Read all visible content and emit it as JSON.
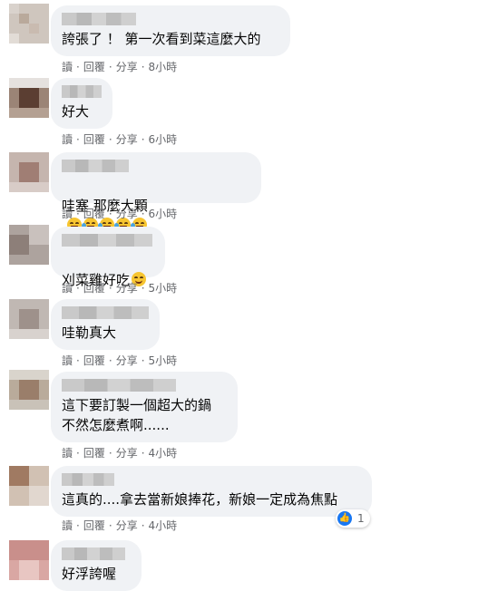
{
  "actions": {
    "read": "讀",
    "reply": "回覆",
    "share": "分享",
    "dot": "·"
  },
  "comments": [
    {
      "text": "誇張了 ！ 第一次看到菜這麼大的",
      "time": "8小時"
    },
    {
      "text": "好大",
      "time": "6小時"
    },
    {
      "text": "哇塞 那麼大顆",
      "time": "6小時",
      "emojis": [
        "grin-sweat",
        "rofl",
        "rofl",
        "rofl",
        "rofl"
      ]
    },
    {
      "text": "刈菜雞好吃",
      "time": "5小時",
      "emojis": [
        "smile"
      ]
    },
    {
      "text": "哇勒真大",
      "time": "5小時"
    },
    {
      "text": "這下要訂製一個超大的鍋\n不然怎麼煮啊......",
      "time": "4小時"
    },
    {
      "text": "這真的....拿去當新娘捧花，新娘一定成為焦點",
      "time": "4小時",
      "reaction": {
        "icon": "like-icon",
        "count": "1"
      }
    },
    {
      "text": "好浮誇喔"
    }
  ],
  "colors": {
    "bubble": "#f0f2f5",
    "meta": "#65676b",
    "like": "#1877f2"
  }
}
